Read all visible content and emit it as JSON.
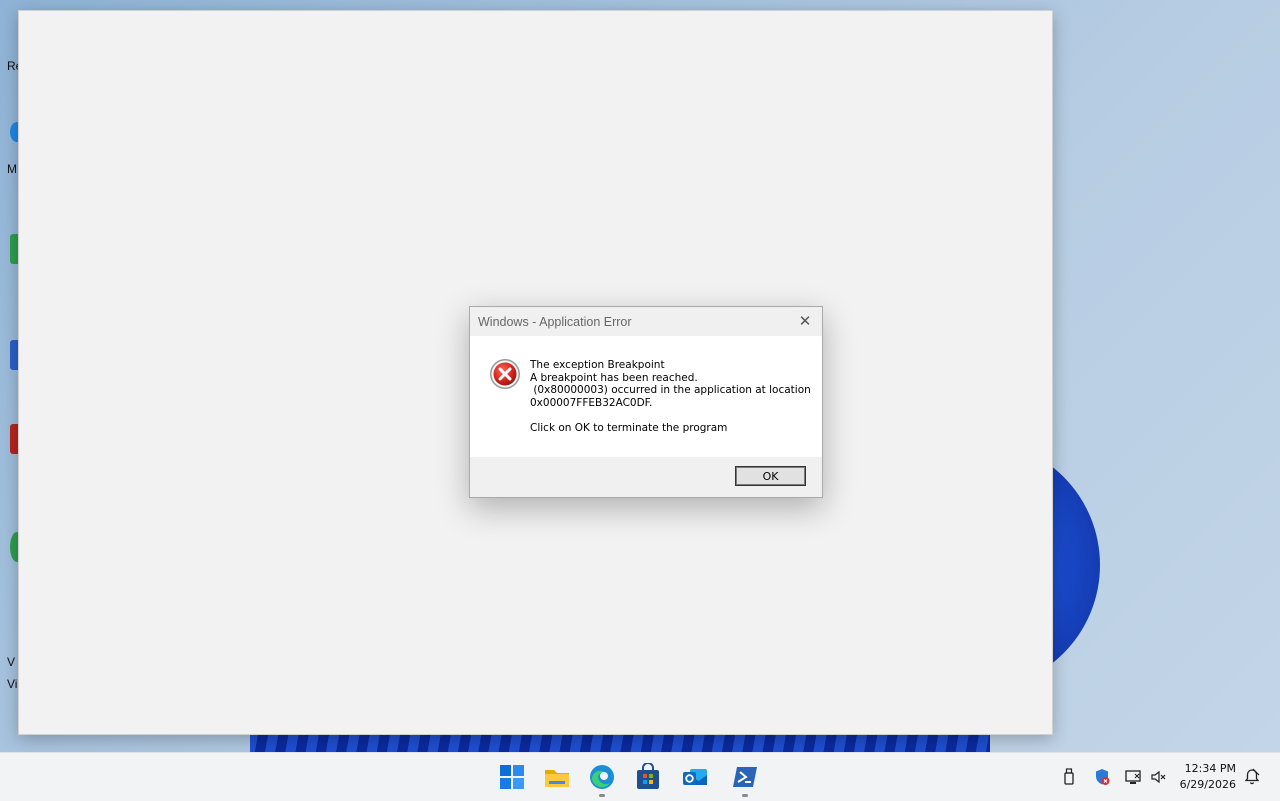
{
  "desktop": {
    "icon_labels": [
      "Re",
      "M",
      "V",
      "Vi"
    ]
  },
  "dialog": {
    "title": "Windows - Application Error",
    "close_symbol": "✕",
    "message": "The exception Breakpoint\nA breakpoint has been reached.\n (0x80000003) occurred in the application at location\n0x00007FFEB32AC0DF.",
    "footer": "Click on OK to terminate the program",
    "ok_label": "OK",
    "icon": "error-icon"
  },
  "taskbar": {
    "apps": [
      "start-icon",
      "file-explorer-icon",
      "edge-icon",
      "store-icon",
      "outlook-icon",
      "powershell-icon"
    ],
    "tray_icons": [
      "usb-icon",
      "security-icon",
      "network-icon",
      "volume-mute-icon"
    ],
    "time": "12:34 PM",
    "date": "6/29/2026",
    "notification_icon": "notification-icon"
  },
  "colors": {
    "error_red": "#c42b1c",
    "accent_blue": "#0067c0"
  }
}
